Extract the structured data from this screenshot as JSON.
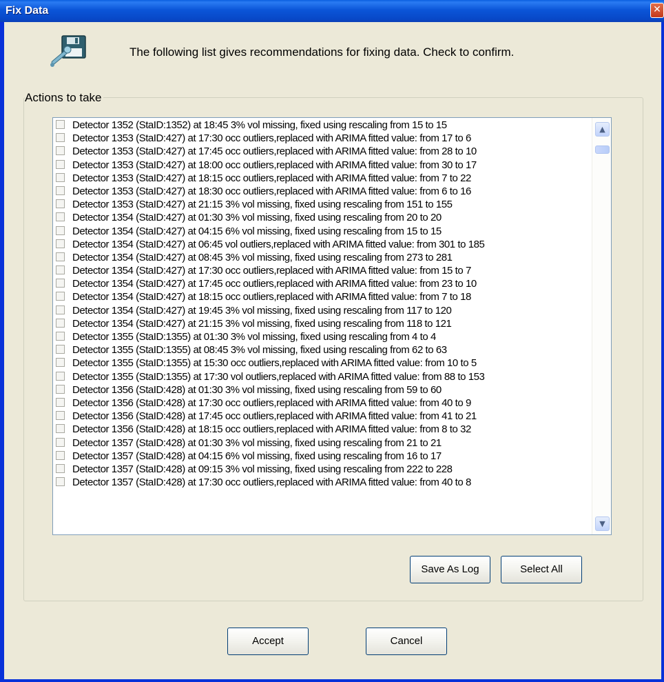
{
  "window": {
    "title": "Fix Data",
    "close_glyph": "✕"
  },
  "header": {
    "icon": "floppy-disk-wrench-icon",
    "message": "The following list gives recommendations for fixing data. Check to confirm."
  },
  "group": {
    "label": "Actions to take"
  },
  "list": {
    "items": [
      {
        "checked": false,
        "text": "Detector 1352 (StaID:1352)  at 18:45 3% vol missing, fixed using rescaling from 15 to 15"
      },
      {
        "checked": false,
        "text": "Detector 1353 (StaID:427)  at 17:30  occ outliers,replaced with ARIMA fitted value: from 17 to 6"
      },
      {
        "checked": false,
        "text": "Detector 1353 (StaID:427)  at 17:45  occ outliers,replaced with ARIMA fitted value: from 28 to 10"
      },
      {
        "checked": false,
        "text": "Detector 1353 (StaID:427)  at 18:00  occ outliers,replaced with ARIMA fitted value: from 30 to 17"
      },
      {
        "checked": false,
        "text": "Detector 1353 (StaID:427)  at 18:15  occ outliers,replaced with ARIMA fitted value: from 7 to 22"
      },
      {
        "checked": false,
        "text": "Detector 1353 (StaID:427)  at 18:30  occ outliers,replaced with ARIMA fitted value: from 6 to 16"
      },
      {
        "checked": false,
        "text": "Detector 1353 (StaID:427)  at 21:15 3% vol missing, fixed using rescaling from 151 to 155"
      },
      {
        "checked": false,
        "text": "Detector 1354 (StaID:427)  at 01:30 3% vol missing, fixed using rescaling from 20 to 20"
      },
      {
        "checked": false,
        "text": "Detector 1354 (StaID:427)  at 04:15 6% vol missing, fixed using rescaling from 15 to 15"
      },
      {
        "checked": false,
        "text": "Detector 1354 (StaID:427)  at 06:45  vol outliers,replaced with ARIMA fitted value: from 301 to 185"
      },
      {
        "checked": false,
        "text": "Detector 1354 (StaID:427)  at 08:45 3% vol missing, fixed using rescaling from 273 to 281"
      },
      {
        "checked": false,
        "text": "Detector 1354 (StaID:427)  at 17:30  occ outliers,replaced with ARIMA fitted value: from 15 to 7"
      },
      {
        "checked": false,
        "text": "Detector 1354 (StaID:427)  at 17:45  occ outliers,replaced with ARIMA fitted value: from 23 to 10"
      },
      {
        "checked": false,
        "text": "Detector 1354 (StaID:427)  at 18:15  occ outliers,replaced with ARIMA fitted value: from 7 to 18"
      },
      {
        "checked": false,
        "text": "Detector 1354 (StaID:427)  at 19:45 3% vol missing, fixed using rescaling from 117 to 120"
      },
      {
        "checked": false,
        "text": "Detector 1354 (StaID:427)  at 21:15 3% vol missing, fixed using rescaling from 118 to 121"
      },
      {
        "checked": false,
        "text": "Detector 1355 (StaID:1355)  at 01:30 3% vol missing, fixed using rescaling from 4 to 4"
      },
      {
        "checked": false,
        "text": "Detector 1355 (StaID:1355)  at 08:45 3% vol missing, fixed using rescaling from 62 to 63"
      },
      {
        "checked": false,
        "text": "Detector 1355 (StaID:1355)  at 15:30  occ outliers,replaced with ARIMA fitted value: from 10 to 5"
      },
      {
        "checked": false,
        "text": "Detector 1355 (StaID:1355)  at 17:30  vol outliers,replaced with ARIMA fitted value: from 88 to 153"
      },
      {
        "checked": false,
        "text": "Detector 1356 (StaID:428)  at 01:30 3% vol missing, fixed using rescaling from 59 to 60"
      },
      {
        "checked": false,
        "text": "Detector 1356 (StaID:428)  at 17:30  occ outliers,replaced with ARIMA fitted value: from 40 to 9"
      },
      {
        "checked": false,
        "text": "Detector 1356 (StaID:428)  at 17:45  occ outliers,replaced with ARIMA fitted value: from 41 to 21"
      },
      {
        "checked": false,
        "text": "Detector 1356 (StaID:428)  at 18:15  occ outliers,replaced with ARIMA fitted value: from 8 to 32"
      },
      {
        "checked": false,
        "text": "Detector 1357 (StaID:428)  at 01:30 3% vol missing, fixed using rescaling from 21 to 21"
      },
      {
        "checked": false,
        "text": "Detector 1357 (StaID:428)  at 04:15 6% vol missing, fixed using rescaling from 16 to 17"
      },
      {
        "checked": false,
        "text": "Detector 1357 (StaID:428)  at 09:15 3% vol missing, fixed using rescaling from 222 to 228"
      },
      {
        "checked": false,
        "text": "Detector 1357 (StaID:428)  at 17:30  occ outliers,replaced with ARIMA fitted value: from 40 to 8"
      }
    ],
    "scrollbar": {
      "up_glyph": "▲",
      "down_glyph": "▼"
    }
  },
  "buttons": {
    "save_as_log": "Save As Log",
    "select_all": "Select All",
    "accept": "Accept",
    "cancel": "Cancel"
  },
  "colors": {
    "titlebar": "#0b55d8",
    "dialog_bg": "#ece9d8",
    "close_button": "#c3381a"
  }
}
